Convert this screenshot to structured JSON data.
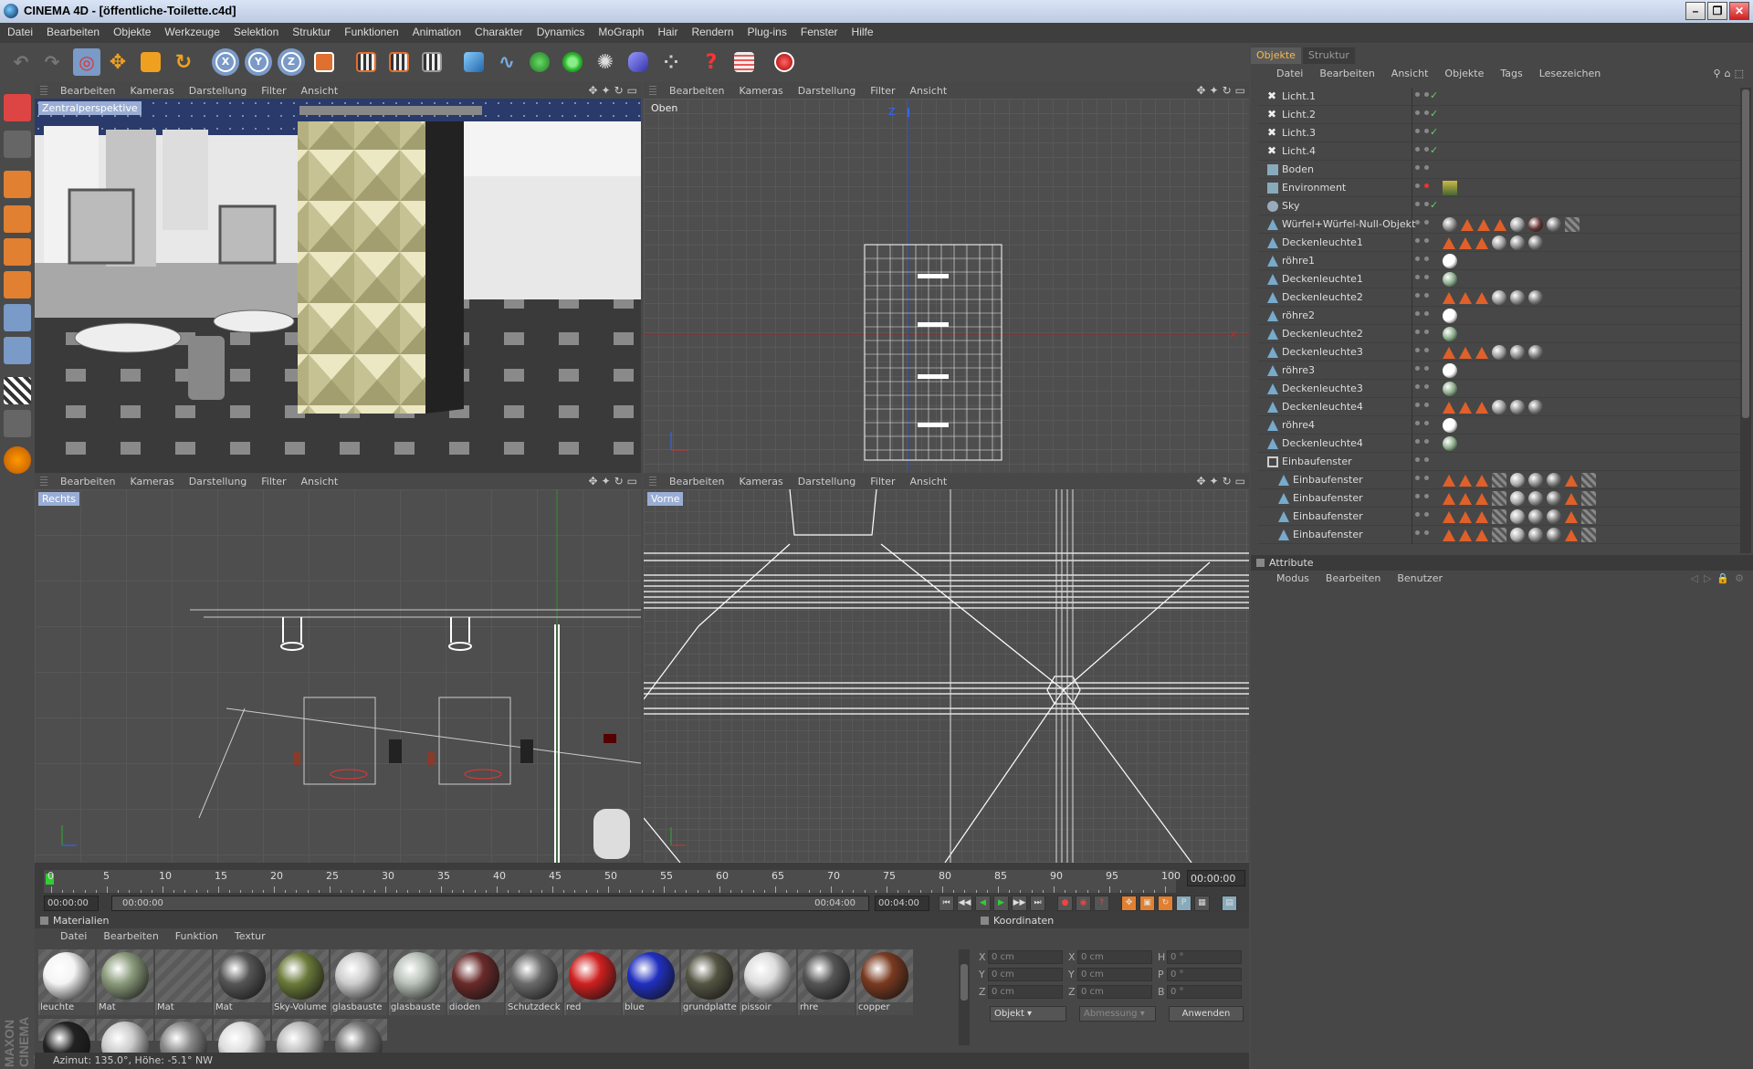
{
  "window": {
    "title": "CINEMA 4D - [öffentliche-Toilette.c4d]"
  },
  "menubar": [
    "Datei",
    "Bearbeiten",
    "Objekte",
    "Werkzeuge",
    "Selektion",
    "Struktur",
    "Funktionen",
    "Animation",
    "Charakter",
    "Dynamics",
    "MoGraph",
    "Hair",
    "Rendern",
    "Plug-ins",
    "Fenster",
    "Hilfe"
  ],
  "toolbar": {
    "x_label": "X",
    "y_label": "Y",
    "z_label": "Z"
  },
  "viewport_menu": [
    "Bearbeiten",
    "Kameras",
    "Darstellung",
    "Filter",
    "Ansicht"
  ],
  "viewports": {
    "perspective": {
      "label": "Zentralperspektive"
    },
    "top": {
      "label": "Oben"
    },
    "right": {
      "label": "Rechts"
    },
    "front": {
      "label": "Vorne"
    }
  },
  "axes": {
    "x": "X",
    "y": "Y",
    "z": "Z"
  },
  "timeline": {
    "ticks": [
      "0",
      "5",
      "10",
      "15",
      "20",
      "25",
      "30",
      "35",
      "40",
      "45",
      "50",
      "55",
      "60",
      "65",
      "70",
      "75",
      "80",
      "85",
      "90",
      "95",
      "100"
    ],
    "current_frame": "00:00:00",
    "start": "00:00:00",
    "range_start": "00:00:00",
    "range_end": "00:04:00",
    "end": "00:04:00"
  },
  "materials": {
    "header": "Materialien",
    "menu": [
      "Datei",
      "Bearbeiten",
      "Funktion",
      "Textur"
    ],
    "items": [
      {
        "name": "leuchte",
        "color": "#f4f4f4"
      },
      {
        "name": "Mat",
        "color": "#8a9a7a"
      },
      {
        "name": "Mat",
        "color": ""
      },
      {
        "name": "Mat",
        "color": "#555555"
      },
      {
        "name": "Sky-Volume",
        "color": "#6a7a3a"
      },
      {
        "name": "glasbauste",
        "color": "#cccccc"
      },
      {
        "name": "glasbauste",
        "color": "#b8c0b8"
      },
      {
        "name": "dioden",
        "color": "#6a2a2a"
      },
      {
        "name": "Schutzdeck",
        "color": "#6a6a6a"
      },
      {
        "name": "red",
        "color": "#d02020"
      },
      {
        "name": "blue",
        "color": "#2030c0"
      },
      {
        "name": "grundplatte",
        "color": "#555544"
      },
      {
        "name": "pissoir",
        "color": "#dddddd"
      },
      {
        "name": "rhre",
        "color": "#555555"
      },
      {
        "name": "copper",
        "color": "#7a3a20"
      }
    ]
  },
  "coordinates": {
    "header": "Koordinaten",
    "rows": [
      {
        "a": "X",
        "av": "0 cm",
        "b": "X",
        "bv": "0 cm",
        "c": "H",
        "cv": "0 °"
      },
      {
        "a": "Y",
        "av": "0 cm",
        "b": "Y",
        "bv": "0 cm",
        "c": "P",
        "cv": "0 °"
      },
      {
        "a": "Z",
        "av": "0 cm",
        "b": "Z",
        "bv": "0 cm",
        "c": "B",
        "cv": "0 °"
      }
    ],
    "mode": "Objekt",
    "size_mode": "Abmessung",
    "apply": "Anwenden"
  },
  "status": "Azimut: 135.0°, Höhe: -5.1°  NW",
  "objects": {
    "tabs": [
      "Objekte",
      "Struktur"
    ],
    "menu": [
      "Datei",
      "Bearbeiten",
      "Ansicht",
      "Objekte",
      "Tags",
      "Lesezeichen"
    ],
    "rows": [
      {
        "name": "Licht.1",
        "indent": 0,
        "icon": "light",
        "tags": "check"
      },
      {
        "name": "Licht.2",
        "indent": 0,
        "icon": "light",
        "tags": "check"
      },
      {
        "name": "Licht.3",
        "indent": 0,
        "icon": "light",
        "tags": "check"
      },
      {
        "name": "Licht.4",
        "indent": 0,
        "icon": "light",
        "tags": "check"
      },
      {
        "name": "Boden",
        "indent": 0,
        "icon": "floor",
        "tags": ""
      },
      {
        "name": "Environment",
        "indent": 0,
        "icon": "env",
        "tags": "envtag"
      },
      {
        "name": "Sky",
        "indent": 0,
        "icon": "sky",
        "tags": "check"
      },
      {
        "name": "Würfel+Würfel-Null-Objekt",
        "indent": 0,
        "icon": "poly",
        "tags": "big"
      },
      {
        "name": "Deckenleuchte1",
        "indent": 0,
        "icon": "poly",
        "tags": "mid"
      },
      {
        "name": "röhre1",
        "indent": 0,
        "icon": "poly",
        "tags": "small"
      },
      {
        "name": "Deckenleuchte1",
        "indent": 0,
        "icon": "poly",
        "tags": "small2"
      },
      {
        "name": "Deckenleuchte2",
        "indent": 0,
        "icon": "poly",
        "tags": "mid"
      },
      {
        "name": "röhre2",
        "indent": 0,
        "icon": "poly",
        "tags": "small"
      },
      {
        "name": "Deckenleuchte2",
        "indent": 0,
        "icon": "poly",
        "tags": "small2"
      },
      {
        "name": "Deckenleuchte3",
        "indent": 0,
        "icon": "poly",
        "tags": "mid"
      },
      {
        "name": "röhre3",
        "indent": 0,
        "icon": "poly",
        "tags": "small"
      },
      {
        "name": "Deckenleuchte3",
        "indent": 0,
        "icon": "poly",
        "tags": "small2"
      },
      {
        "name": "Deckenleuchte4",
        "indent": 0,
        "icon": "poly",
        "tags": "mid"
      },
      {
        "name": "röhre4",
        "indent": 0,
        "icon": "poly",
        "tags": "small"
      },
      {
        "name": "Deckenleuchte4",
        "indent": 0,
        "icon": "poly",
        "tags": "small2"
      },
      {
        "name": "Einbaufenster",
        "indent": 0,
        "icon": "null",
        "tags": ""
      },
      {
        "name": "Einbaufenster",
        "indent": 1,
        "icon": "poly",
        "tags": "win"
      },
      {
        "name": "Einbaufenster",
        "indent": 1,
        "icon": "poly",
        "tags": "win"
      },
      {
        "name": "Einbaufenster",
        "indent": 1,
        "icon": "poly",
        "tags": "win"
      },
      {
        "name": "Einbaufenster",
        "indent": 1,
        "icon": "poly",
        "tags": "win"
      }
    ]
  },
  "attributes": {
    "header": "Attribute",
    "menu": [
      "Modus",
      "Bearbeiten",
      "Benutzer"
    ]
  },
  "maxon_logo": "MAXON CINEMA 4D"
}
